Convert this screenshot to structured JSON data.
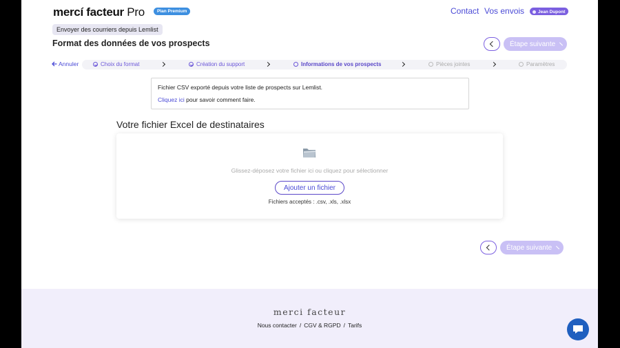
{
  "header": {
    "logo_main": "mercí facteur",
    "logo_suffix": " Pro",
    "plan_badge": "Plan Premium",
    "nav": [
      "Contact",
      "Vos envois"
    ],
    "user_name": "Jean Dupont"
  },
  "context_tag": "Envoyer des courriers depuis Lemlist",
  "page_title": "Format des données de vos prospects",
  "buttons": {
    "next_label": "Étape suivante"
  },
  "steps": {
    "cancel_label": "Annuler",
    "items": [
      {
        "label": "Choix du format",
        "state": "done"
      },
      {
        "label": "Création du support",
        "state": "done"
      },
      {
        "label": "Informations de vos prospects",
        "state": "current"
      },
      {
        "label": "Pièces jointes",
        "state": "future"
      },
      {
        "label": "Paramètres",
        "state": "future"
      }
    ]
  },
  "info": {
    "line1": "Fichier CSV exporté depuis votre liste de prospects sur Lemlist.",
    "link": "Cliquez ici",
    "line2_rest": " pour savoir comment faire."
  },
  "upload": {
    "section_title": "Votre fichier Excel de destinataires",
    "icon": "folder-icon",
    "hint": "Glissez-déposez votre fichier ici ou cliquez pour sélectionner",
    "add_button": "Ajouter un fichier",
    "accepted": "Fichiers acceptés : .csv, .xls, .xlsx"
  },
  "footer": {
    "logo": "merci facteur",
    "links": [
      "Nous contacter",
      "CGV & RGPD",
      "Tarifs"
    ],
    "separator": "/"
  },
  "colors": {
    "accent": "#4a4ad6",
    "primary_disabled": "#c9c0f5",
    "footer_bg": "#f1eefb",
    "chat_button": "#1f5fbf"
  }
}
